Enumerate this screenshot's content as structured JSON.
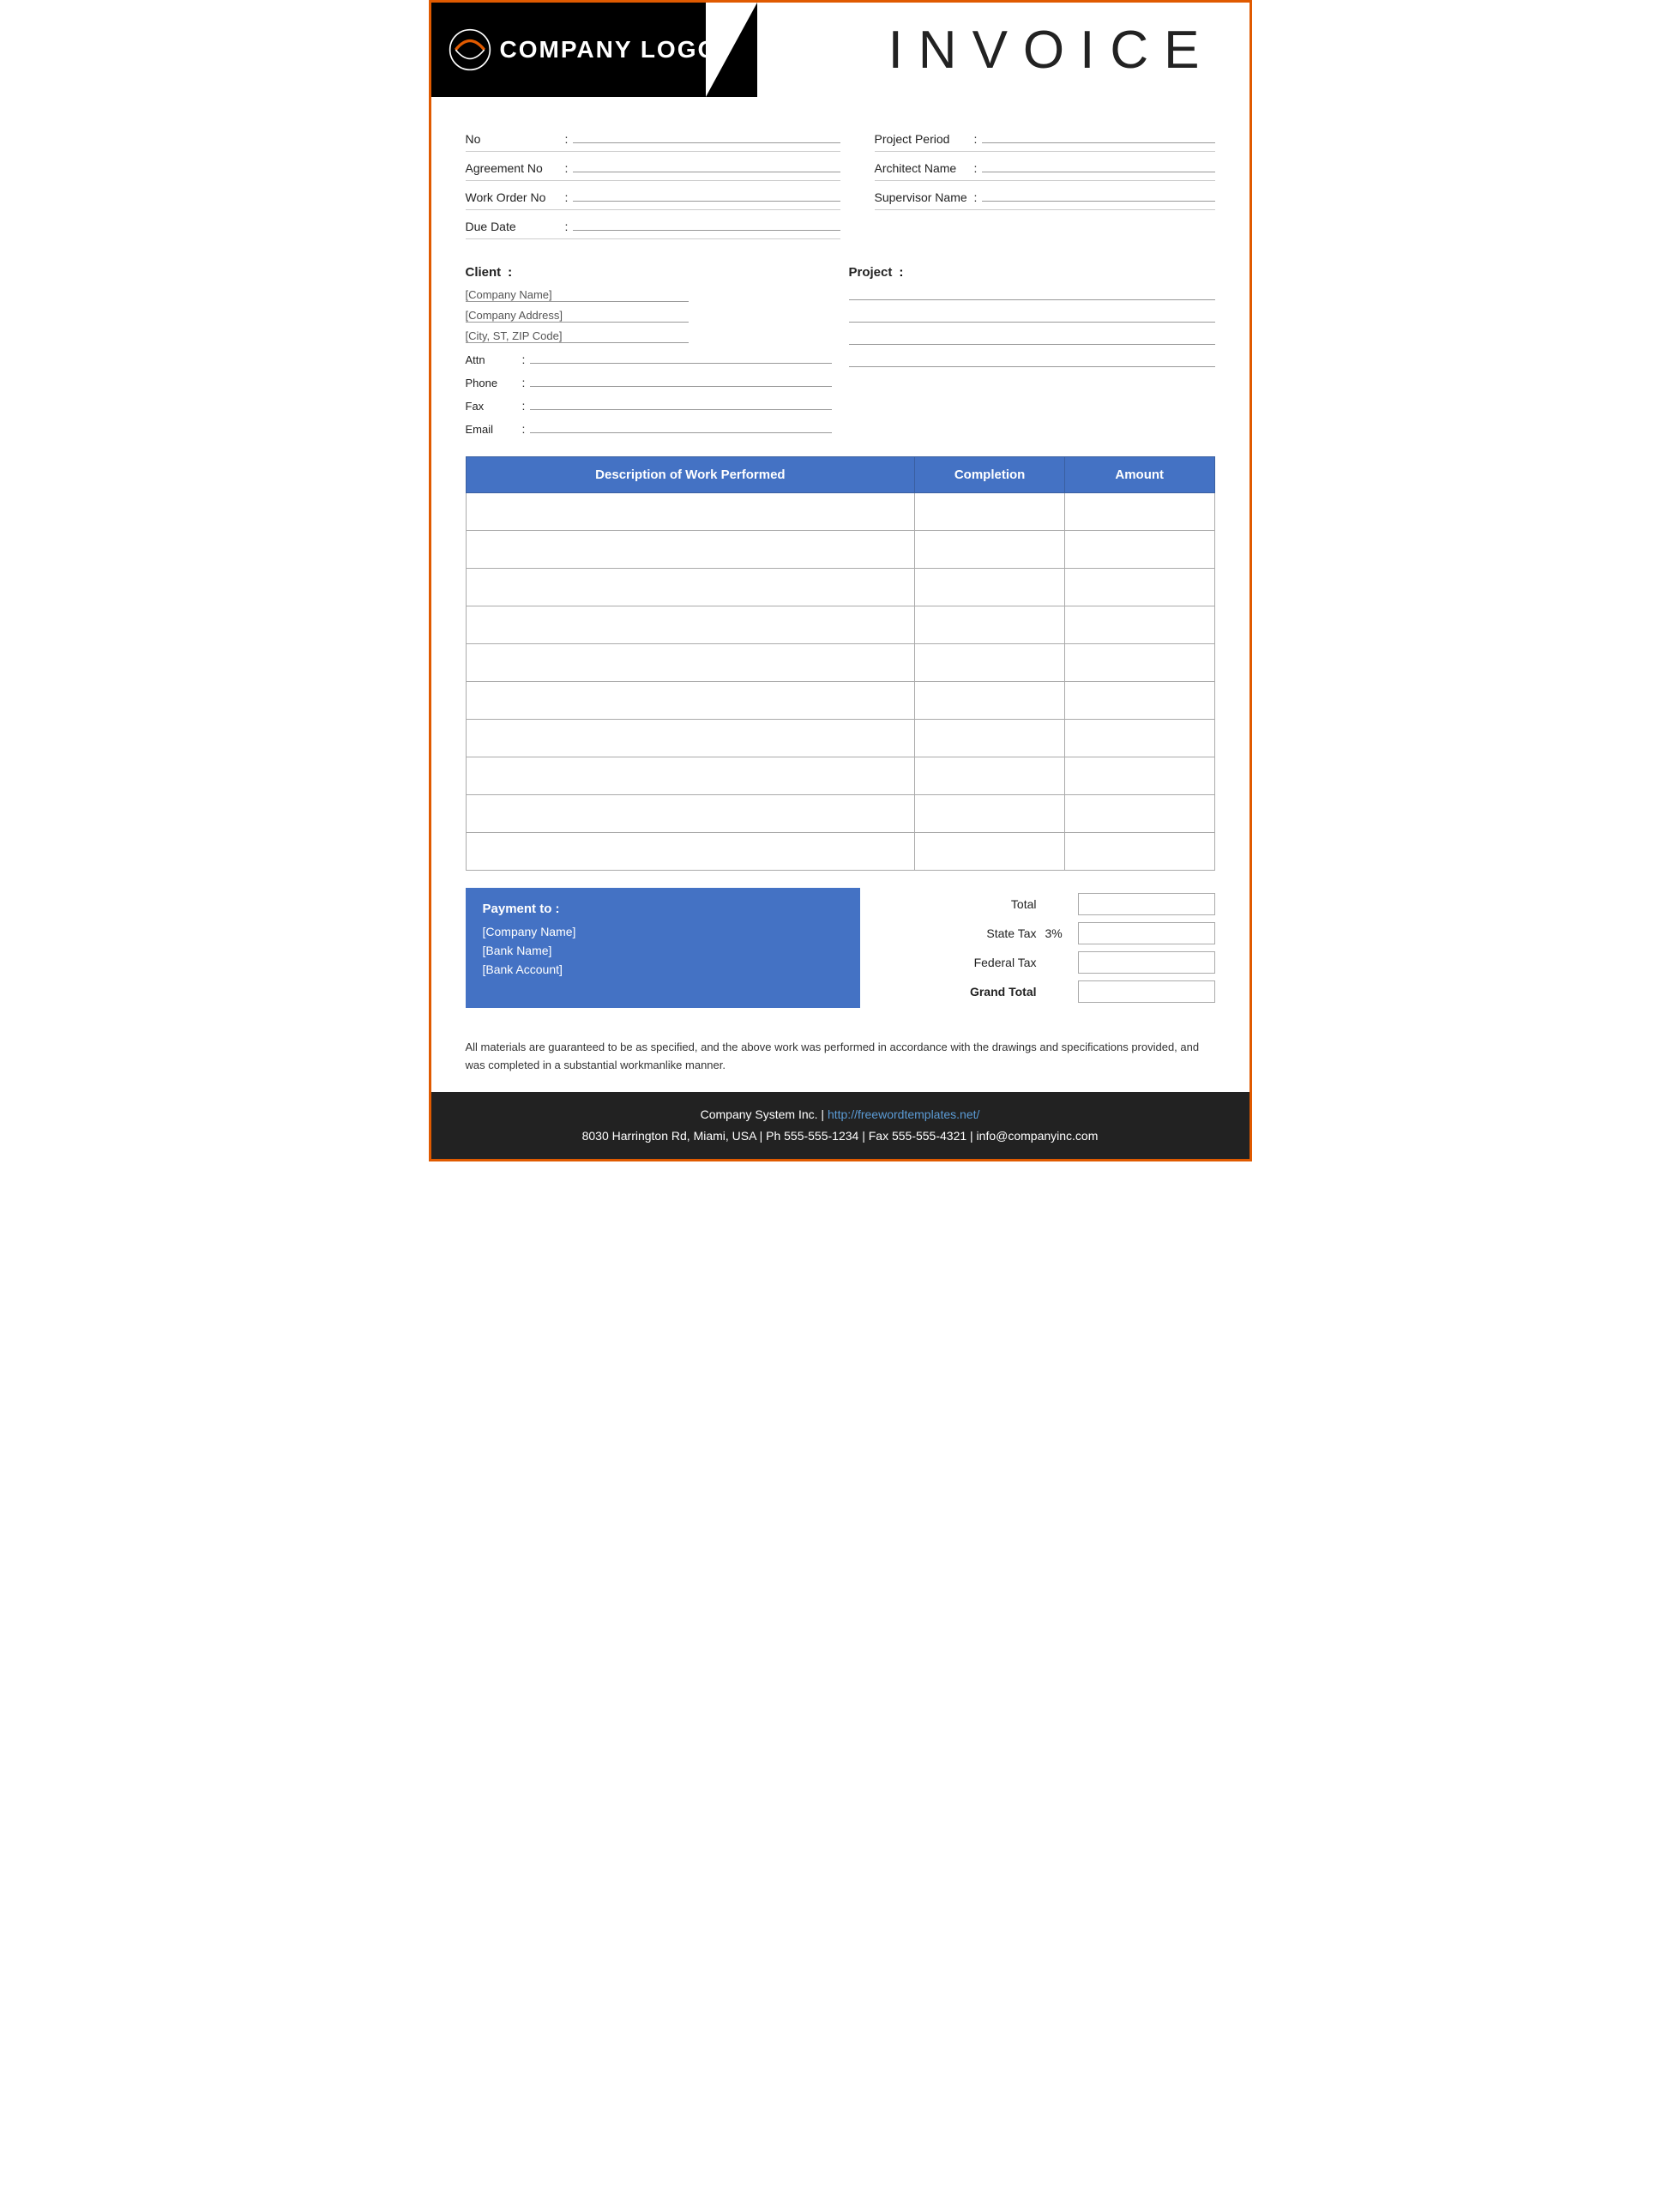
{
  "header": {
    "logo_text": "COMPANY LOGO",
    "title": "INVOICE"
  },
  "info": {
    "left": [
      {
        "label": "No",
        "colon": ":",
        "value": ""
      },
      {
        "label": "Agreement No",
        "colon": ":",
        "value": ""
      },
      {
        "label": "Work Order No",
        "colon": ":",
        "value": ""
      },
      {
        "label": "Due Date",
        "colon": ":",
        "value": ""
      }
    ],
    "right": [
      {
        "label": "Project Period",
        "colon": ":",
        "value": ""
      },
      {
        "label": "Architect Name",
        "colon": ":",
        "value": ""
      },
      {
        "label": "Supervisor Name",
        "colon": ":",
        "value": ""
      }
    ]
  },
  "client": {
    "label": "Client",
    "colon": ":",
    "name": "[Company Name]",
    "address": "[Company Address]",
    "city": "[City, ST, ZIP Code]",
    "fields": [
      {
        "label": "Attn",
        "colon": ":",
        "value": ""
      },
      {
        "label": "Phone",
        "colon": ":",
        "value": ""
      },
      {
        "label": "Fax",
        "colon": ":",
        "value": ""
      },
      {
        "label": "Email",
        "colon": ":",
        "value": ""
      }
    ]
  },
  "project": {
    "label": "Project",
    "colon": ":"
  },
  "table": {
    "columns": [
      {
        "key": "desc",
        "label": "Description of Work Performed"
      },
      {
        "key": "completion",
        "label": "Completion"
      },
      {
        "key": "amount",
        "label": "Amount"
      }
    ],
    "empty_rows": 10
  },
  "payment": {
    "label": "Payment to :",
    "company": "[Company Name]",
    "bank": "[Bank Name]",
    "account": "[Bank Account]"
  },
  "totals": [
    {
      "label": "Total",
      "pct": "",
      "bold": false
    },
    {
      "label": "State Tax",
      "pct": "3%",
      "bold": false
    },
    {
      "label": "Federal Tax",
      "pct": "",
      "bold": false
    },
    {
      "label": "Grand Total",
      "pct": "",
      "bold": true
    }
  ],
  "footer_note": "All materials are guaranteed to be as specified, and the above work was performed in accordance with the drawings and specifications provided, and was completed in a substantial workmanlike manner.",
  "footer": {
    "company": "Company System Inc.",
    "separator": "|",
    "website": "http://freewordtemplates.net/",
    "address": "8030 Harrington Rd, Miami, USA | Ph 555-555-1234 | Fax 555-555-4321 | info@companyinc.com"
  }
}
